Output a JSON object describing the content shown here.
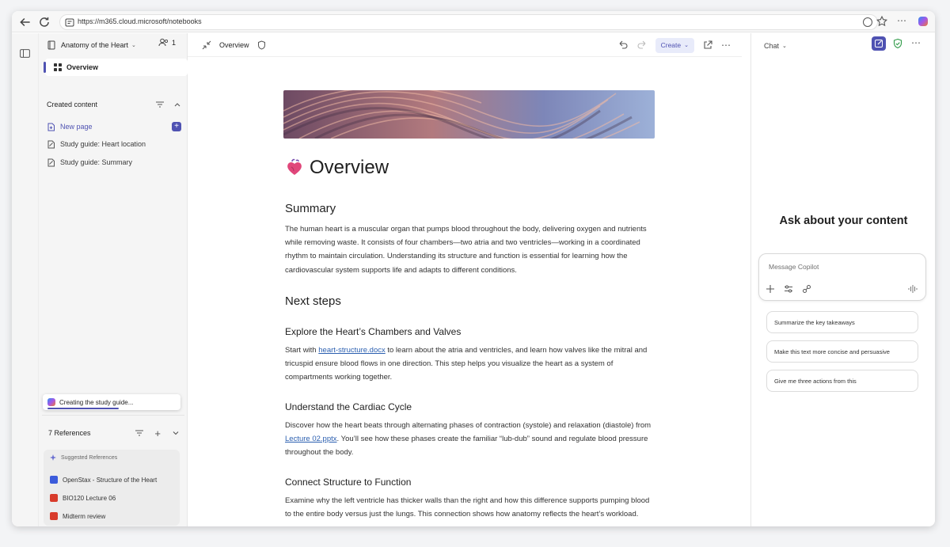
{
  "browser": {
    "url": "https://m365.cloud.microsoft/notebooks"
  },
  "sidebar": {
    "notebook_title": "Anatomy of the Heart",
    "member_count": "1",
    "overview_label": "Overview",
    "created_content": {
      "heading": "Created content",
      "items": [
        {
          "label": "New page",
          "icon": "new-page-icon"
        },
        {
          "label": "Study guide: Heart location",
          "icon": "study-guide-icon"
        },
        {
          "label": "Study guide: Summary",
          "icon": "study-guide-icon"
        }
      ]
    },
    "toast": "Creating the study guide...",
    "references": {
      "heading": "7 References",
      "suggested_label": "Suggested References",
      "items": [
        {
          "label": "OpenStax - Structure of the Heart",
          "color": "#3b5bdb"
        },
        {
          "label": "BIO120 Lecture 06",
          "color": "#d83b2b"
        },
        {
          "label": "Midterm review",
          "color": "#d83b2b"
        }
      ]
    }
  },
  "toolbar": {
    "page_label": "Overview",
    "create_label": "Create"
  },
  "document": {
    "title": "Overview",
    "summary_heading": "Summary",
    "summary_text": "The human heart is a muscular organ that pumps blood throughout the body, delivering oxygen and nutrients while removing waste. It consists of four chambers—two atria and two ventricles—working in a coordinated rhythm to maintain circulation. Understanding its structure and function is essential for learning how the cardiovascular system supports life and adapts to different conditions.",
    "next_steps_heading": "Next steps",
    "step1": {
      "heading": "Explore the Heart’s Chambers and Valves",
      "pre": "Start with ",
      "link": "heart-structure.docx",
      "post": " to learn about the atria and ventricles, and learn how valves like the mitral and tricuspid ensure blood flows in one direction. This step helps you visualize the heart as a system of compartments working together."
    },
    "step2": {
      "heading": "Understand the Cardiac Cycle",
      "pre": "Discover how the heart beats through alternating phases of contraction (systole) and relaxation (diastole) from ",
      "link": "Lecture 02.pptx",
      "post": ". You’ll see how these phases create the familiar “lub-dub” sound and regulate blood pressure throughout the body."
    },
    "step3": {
      "heading": "Connect Structure to Function",
      "text": "Examine why the left ventricle has thicker walls than the right and how this difference supports pumping blood to the entire body versus just the lungs. This connection shows how anatomy reflects the heart’s workload."
    }
  },
  "chat": {
    "header_label": "Chat",
    "heading": "Ask about your content",
    "placeholder": "Message Copilot",
    "suggestions": [
      "Summarize the key takeaways",
      "Make this text more concise and persuasive",
      "Give me three actions from this"
    ]
  },
  "colors": {
    "accent": "#4f52b2",
    "link": "#2b5fb0"
  }
}
